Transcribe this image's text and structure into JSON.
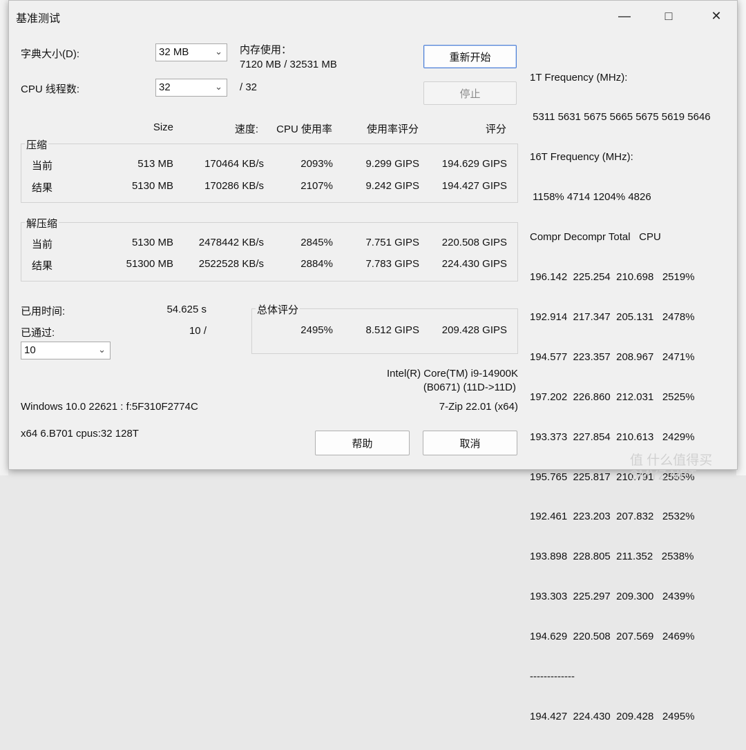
{
  "window": {
    "title": "基准测试",
    "min_icon": "minimize-icon",
    "max_icon": "maximize-icon",
    "close_icon": "close-icon"
  },
  "settings": {
    "dict_label": "字典大小(D):",
    "dict_value": "32 MB",
    "threads_label": "CPU 线程数:",
    "threads_value": "32",
    "threads_max": "/ 32",
    "mem_label": "内存使用：",
    "mem_value": "7120 MB / 32531 MB"
  },
  "buttons": {
    "restart": "重新开始",
    "stop": "停止",
    "help": "帮助",
    "cancel": "取消"
  },
  "columns": [
    "Size",
    "速度:",
    "CPU 使用率",
    "使用率评分",
    "评分"
  ],
  "compress": {
    "label": "压缩",
    "rows": [
      {
        "label": "当前",
        "size": "513 MB",
        "speed": "170464 KB/s",
        "cpu": "2093%",
        "usage_score": "9.299 GIPS",
        "score": "194.629 GIPS"
      },
      {
        "label": "结果",
        "size": "5130 MB",
        "speed": "170286 KB/s",
        "cpu": "2107%",
        "usage_score": "9.242 GIPS",
        "score": "194.427 GIPS"
      }
    ]
  },
  "decompress": {
    "label": "解压缩",
    "rows": [
      {
        "label": "当前",
        "size": "5130 MB",
        "speed": "2478442 KB/s",
        "cpu": "2845%",
        "usage_score": "7.751 GIPS",
        "score": "220.508 GIPS"
      },
      {
        "label": "结果",
        "size": "51300 MB",
        "speed": "2522528 KB/s",
        "cpu": "2884%",
        "usage_score": "7.783 GIPS",
        "score": "224.430 GIPS"
      }
    ]
  },
  "elapsed": {
    "label": "已用时间:",
    "value": "54.625 s"
  },
  "passed": {
    "label": "已通过:",
    "value": "10 /",
    "select_value": "10"
  },
  "total": {
    "label": "总体评分",
    "cpu": "2495%",
    "usage_score": "8.512 GIPS",
    "score": "209.428 GIPS"
  },
  "cpu_info": {
    "line1": "Intel(R) Core(TM) i9-14900K",
    "line2": "(B0671) (11D->11D)"
  },
  "os_info": "Windows 10.0 22621 : f:5F310F2774C",
  "version": "7-Zip 22.01 (x64)",
  "arch_info": "x64 6.B701 cpus:32 128T",
  "log": [
    "1T Frequency (MHz):",
    " 5311 5631 5675 5665 5675 5619 5646",
    "16T Frequency (MHz):",
    " 1158% 4714 1204% 4826",
    "Compr Decompr Total   CPU",
    "196.142  225.254  210.698   2519%",
    "192.914  217.347  205.131   2478%",
    "194.577  223.357  208.967   2471%",
    "197.202  226.860  212.031   2525%",
    "193.373  227.854  210.613   2429%",
    "195.765  225.817  210.791   2555%",
    "192.461  223.203  207.832   2532%",
    "193.898  228.805  211.352   2538%",
    "193.303  225.297  209.300   2439%",
    "194.629  220.508  207.569   2469%",
    "-------------",
    "194.427  224.430  209.428   2495%"
  ],
  "watermark": "值 什么值得买 SMYZ.NET"
}
